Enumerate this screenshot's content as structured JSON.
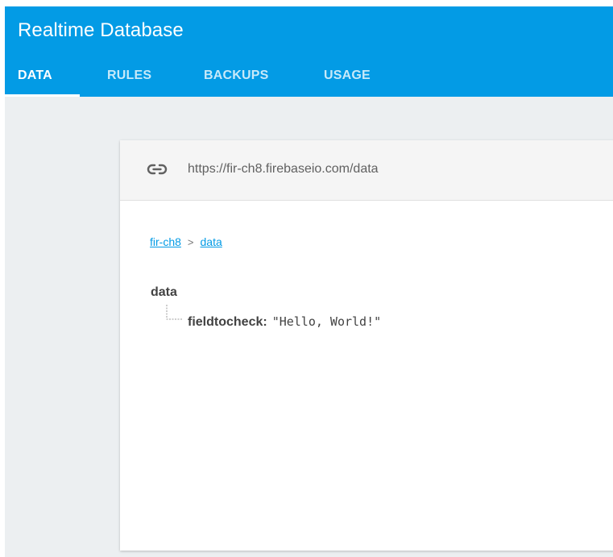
{
  "app": {
    "title": "Realtime Database"
  },
  "tabs": [
    {
      "label": "DATA",
      "active": true
    },
    {
      "label": "RULES",
      "active": false
    },
    {
      "label": "BACKUPS",
      "active": false
    },
    {
      "label": "USAGE",
      "active": false
    }
  ],
  "url_bar": {
    "icon": "link-icon",
    "url": "https://fir-ch8.firebaseio.com/data"
  },
  "breadcrumb": {
    "items": [
      "fir-ch8",
      "data"
    ],
    "separator": ">"
  },
  "tree": {
    "root": "data",
    "children": [
      {
        "key": "fieldtocheck:",
        "value": "\"Hello, World!\""
      }
    ]
  },
  "colors": {
    "header": "#039be5",
    "background": "#eceff1",
    "link": "#039be5",
    "panel": "#ffffff"
  }
}
